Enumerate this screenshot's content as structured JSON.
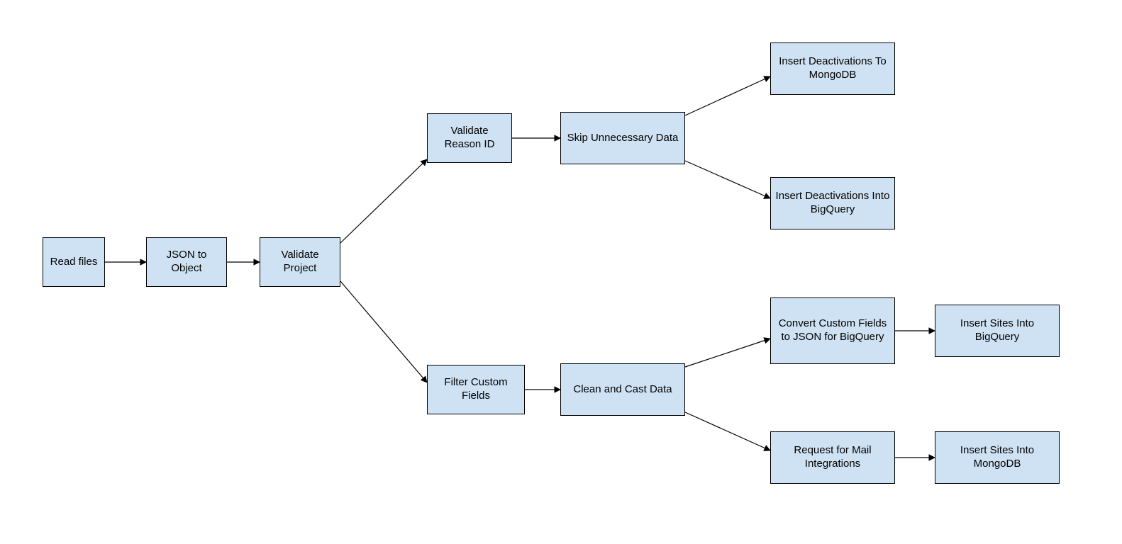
{
  "diagram": {
    "type": "flowchart",
    "colors": {
      "node_fill": "#cfe2f3",
      "node_stroke": "#000000",
      "edge_stroke": "#000000"
    },
    "nodes": {
      "read_files": {
        "label": "Read files"
      },
      "json_to_object": {
        "label": "JSON to Object"
      },
      "validate_project": {
        "label": "Validate Project"
      },
      "validate_reason": {
        "label": "Validate Reason ID"
      },
      "skip_unnecessary": {
        "label": "Skip Unnecessary Data"
      },
      "insert_deact_mongo": {
        "label": "Insert Deactivations To MongoDB"
      },
      "insert_deact_bq": {
        "label": "Insert Deactivations Into BigQuery"
      },
      "filter_custom": {
        "label": "Filter Custom Fields"
      },
      "clean_cast": {
        "label": "Clean and Cast Data"
      },
      "convert_custom": {
        "label": "Convert Custom Fields to JSON for BigQuery"
      },
      "request_mail": {
        "label": "Request for Mail Integrations"
      },
      "insert_sites_bq": {
        "label": "Insert Sites Into BigQuery"
      },
      "insert_sites_mongo": {
        "label": "Insert Sites Into MongoDB"
      }
    },
    "edges": [
      [
        "read_files",
        "json_to_object"
      ],
      [
        "json_to_object",
        "validate_project"
      ],
      [
        "validate_project",
        "validate_reason"
      ],
      [
        "validate_project",
        "filter_custom"
      ],
      [
        "validate_reason",
        "skip_unnecessary"
      ],
      [
        "skip_unnecessary",
        "insert_deact_mongo"
      ],
      [
        "skip_unnecessary",
        "insert_deact_bq"
      ],
      [
        "filter_custom",
        "clean_cast"
      ],
      [
        "clean_cast",
        "convert_custom"
      ],
      [
        "clean_cast",
        "request_mail"
      ],
      [
        "convert_custom",
        "insert_sites_bq"
      ],
      [
        "request_mail",
        "insert_sites_mongo"
      ]
    ]
  }
}
